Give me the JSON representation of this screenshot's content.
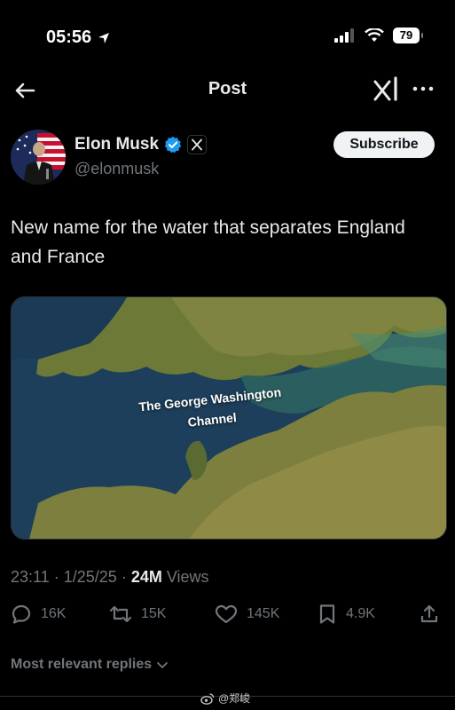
{
  "status_bar": {
    "time": "05:56",
    "battery": "79"
  },
  "header": {
    "title": "Post"
  },
  "author": {
    "name": "Elon Musk",
    "handle": "@elonmusk",
    "subscribe_label": "Subscribe"
  },
  "tweet": {
    "text": "New name for the water that separates England and France",
    "image_caption": "The George Washington Channel"
  },
  "meta": {
    "time": "23:11",
    "date": "1/25/25",
    "views": "24M",
    "views_label": "Views"
  },
  "actions": {
    "replies": "16K",
    "reposts": "15K",
    "likes": "145K",
    "bookmarks": "4.9K"
  },
  "replies_sort": "Most relevant replies",
  "watermark": "@郑峻",
  "colors": {
    "background": "#000000",
    "verified": "#1d9bf0",
    "muted": "#71767b",
    "text": "#e7e9ea"
  }
}
